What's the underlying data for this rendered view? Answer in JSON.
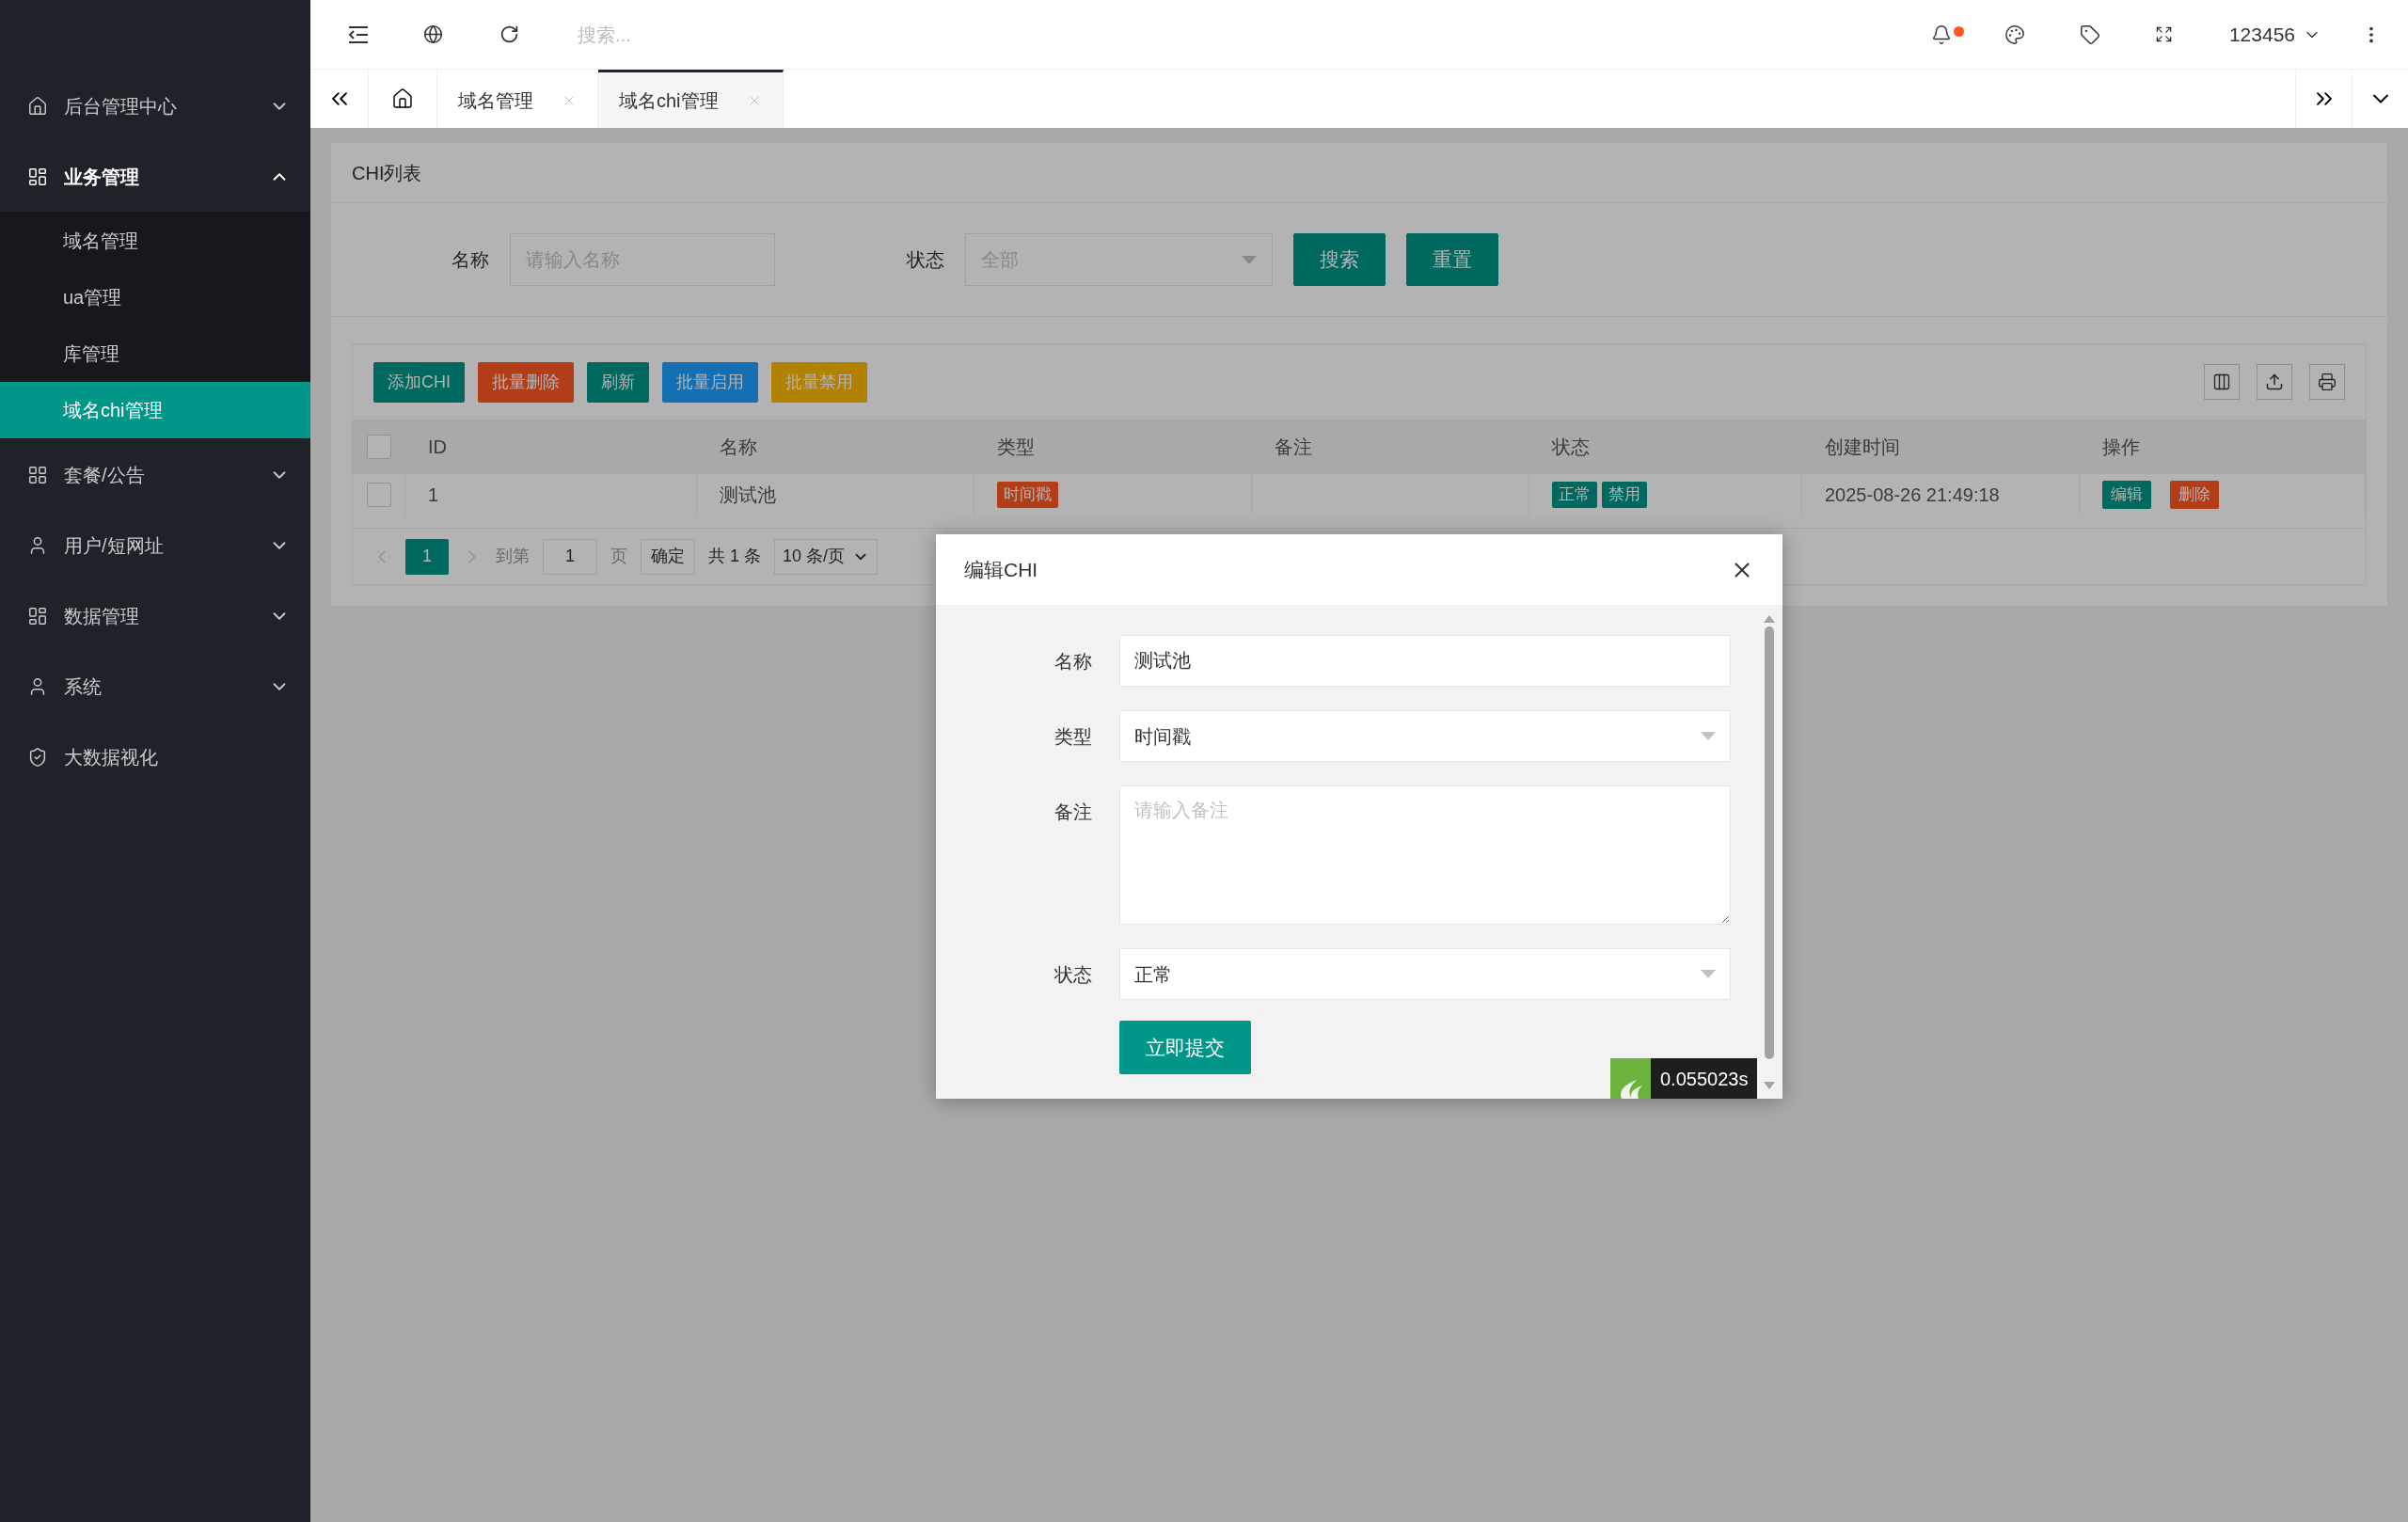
{
  "header": {
    "search_placeholder": "搜索...",
    "notification_dot": true,
    "user": "123456"
  },
  "sidebar": {
    "items": [
      {
        "label": "后台管理中心",
        "expanded": false
      },
      {
        "label": "业务管理",
        "expanded": true,
        "children": [
          {
            "label": "域名管理",
            "selected": false
          },
          {
            "label": "ua管理",
            "selected": false
          },
          {
            "label": "库管理",
            "selected": false
          },
          {
            "label": "域名chi管理",
            "selected": true
          }
        ]
      },
      {
        "label": "套餐/公告",
        "expanded": false
      },
      {
        "label": "用户/短网址",
        "expanded": false
      },
      {
        "label": "数据管理",
        "expanded": false
      },
      {
        "label": "系统",
        "expanded": false
      },
      {
        "label": "大数据视化",
        "kind": "link"
      }
    ]
  },
  "tabs": [
    {
      "label": "域名管理",
      "selected": false
    },
    {
      "label": "域名chi管理",
      "selected": true
    }
  ],
  "card": {
    "title": "CHI列表",
    "filters": [
      {
        "label": "名称",
        "kind": "input",
        "placeholder": "请输入名称"
      },
      {
        "label": "状态",
        "kind": "select",
        "placeholder": "全部"
      }
    ],
    "filter_buttons": [
      "搜索",
      "重置"
    ],
    "toolbar": [
      {
        "label": "添加CHI",
        "color": "#00695f"
      },
      {
        "label": "批量删除",
        "color": "#b33d18"
      },
      {
        "label": "刷新",
        "color": "#00695f"
      },
      {
        "label": "批量启用",
        "color": "#156fb3"
      },
      {
        "label": "批量禁用",
        "color": "#b38100"
      }
    ],
    "table": {
      "all_checked": false,
      "columns": [
        "ID",
        "名称",
        "类型",
        "备注",
        "状态",
        "创建时间",
        "操作"
      ],
      "rows": [
        {
          "checked": false,
          "id": "1",
          "name": "测试池",
          "type": [
            {
              "text": "时间戳",
              "color": "#b33d18"
            }
          ],
          "status": [
            {
              "text": "正常",
              "color": "#00695f"
            },
            {
              "text": "禁用",
              "color": "#00695f"
            }
          ],
          "created": "2025-08-26 21:49:18",
          "actions": [
            {
              "label": "编辑",
              "color": "#00695f"
            },
            {
              "label": "删除",
              "color": "#b33d18"
            }
          ]
        }
      ]
    },
    "pagination": {
      "pages": [
        {
          "label": "1",
          "selected": true
        }
      ],
      "goto_label": "到第",
      "goto_value": "1",
      "page_unit": "页",
      "confirm": "确定",
      "total": "共 1 条",
      "page_size": "10 条/页"
    }
  },
  "modal": {
    "title": "编辑CHI",
    "fields": [
      {
        "label": "名称",
        "kind": "input",
        "value": "测试池"
      },
      {
        "label": "类型",
        "kind": "select",
        "value": "时间戳"
      },
      {
        "label": "备注",
        "kind": "textarea",
        "placeholder": "请输入备注"
      },
      {
        "label": "状态",
        "kind": "select",
        "value": "正常"
      }
    ],
    "submit": "立即提交"
  },
  "trace": {
    "time": "0.055023s"
  }
}
